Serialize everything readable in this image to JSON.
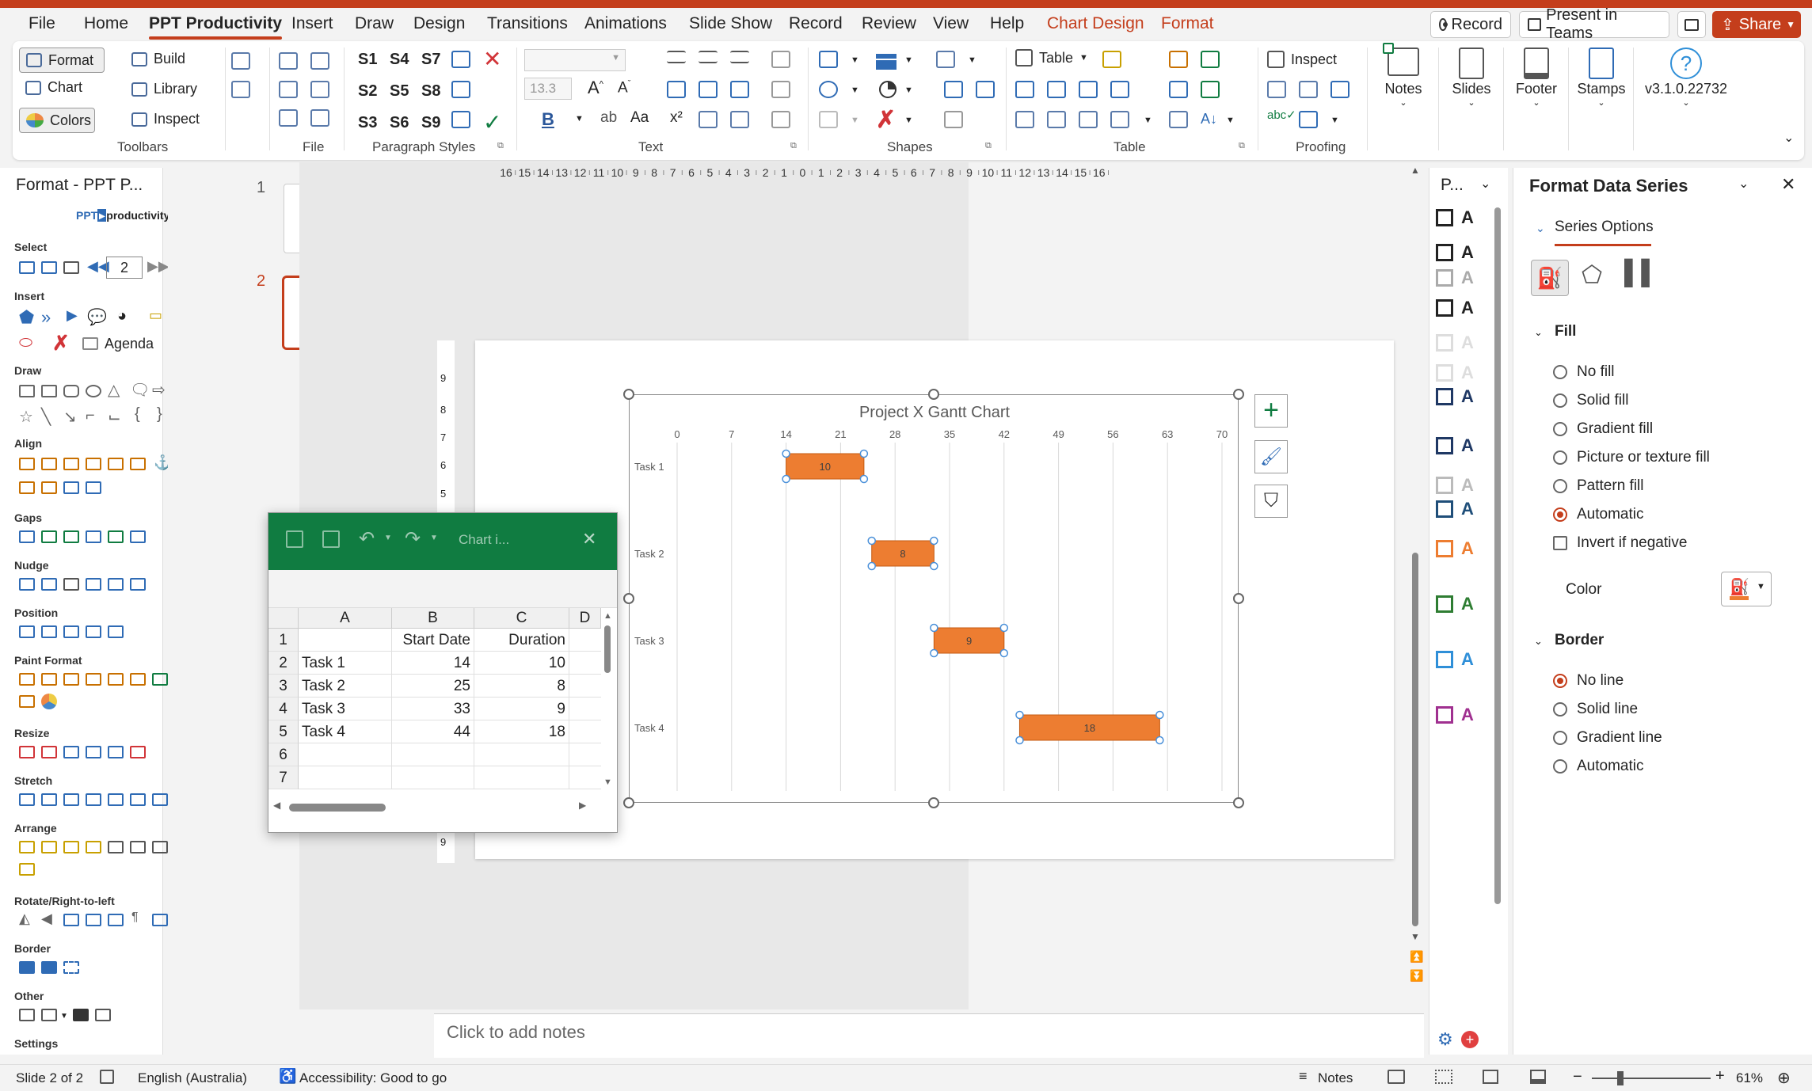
{
  "menu": {
    "tabs": [
      "File",
      "Home",
      "PPT Productivity",
      "Insert",
      "Draw",
      "Design",
      "Transitions",
      "Animations",
      "Slide Show",
      "Record",
      "Review",
      "View",
      "Help",
      "Chart Design",
      "Format"
    ],
    "active_tab": "PPT Productivity",
    "record_btn": "Record",
    "present_btn": "Present in Teams",
    "share_btn": "Share"
  },
  "ribbon": {
    "toolbars": {
      "format": "Format",
      "chart": "Chart",
      "colors": "Colors",
      "build": "Build",
      "library": "Library",
      "inspect": "Inspect",
      "label": "Toolbars"
    },
    "file_label": "File",
    "paragraph_styles": {
      "label": "Paragraph Styles",
      "s": [
        "S1",
        "S4",
        "S7",
        "S2",
        "S5",
        "S8",
        "S3",
        "S6",
        "S9"
      ]
    },
    "text": {
      "label": "Text",
      "font_size": "13.3"
    },
    "shapes_label": "Shapes",
    "table": {
      "label": "Table",
      "table_btn": "Table"
    },
    "proofing": {
      "label": "Proofing",
      "inspect": "Inspect"
    },
    "notes": "Notes",
    "slides": "Slides",
    "footer": "Footer",
    "stamps": "Stamps",
    "version": "v3.1.0.22732"
  },
  "left_pane": {
    "title": "Format - PPT P...",
    "logo": "productivity",
    "logo_prefix": "PPT",
    "sections": [
      "Select",
      "Insert",
      "Draw",
      "Align",
      "Gaps",
      "Nudge",
      "Position",
      "Paint Format",
      "Resize",
      "Stretch",
      "Arrange",
      "Rotate/Right-to-left",
      "Border",
      "Other",
      "Settings"
    ],
    "select_value": "2",
    "agenda": "Agenda"
  },
  "thumbnails": [
    "1",
    "2"
  ],
  "ruler": {
    "h_labels": [
      "16",
      "15",
      "14",
      "13",
      "12",
      "11",
      "10",
      "9",
      "8",
      "7",
      "6",
      "5",
      "4",
      "3",
      "2",
      "1",
      "0",
      "1",
      "2",
      "3",
      "4",
      "5",
      "6",
      "7",
      "8",
      "9",
      "10",
      "11",
      "12",
      "13",
      "14",
      "15",
      "16"
    ],
    "v_labels": [
      "9",
      "8",
      "7",
      "6",
      "5",
      "4"
    ],
    "v_bottom": "9"
  },
  "notes_placeholder": "Click to add notes",
  "chart_data": {
    "type": "bar",
    "title": "Project X Gantt Chart",
    "orientation": "horizontal-gantt",
    "categories": [
      "Task 1",
      "Task 2",
      "Task 3",
      "Task 4"
    ],
    "series": [
      {
        "name": "Start Date",
        "values": [
          14,
          25,
          33,
          44
        ],
        "hidden": true
      },
      {
        "name": "Duration",
        "values": [
          10,
          8,
          9,
          18
        ],
        "color": "#ed7d31"
      }
    ],
    "x_ticks": [
      "0",
      "7",
      "14",
      "21",
      "28",
      "35",
      "42",
      "49",
      "56",
      "63",
      "70"
    ],
    "xlim": [
      0,
      70
    ],
    "grid": true
  },
  "worksheet": {
    "title": "Chart i...",
    "columns": [
      "A",
      "B",
      "C",
      "D"
    ],
    "rows": [
      "1",
      "2",
      "3",
      "4",
      "5",
      "6",
      "7"
    ],
    "cells": [
      [
        "",
        "Start Date",
        "Duration"
      ],
      [
        "Task 1",
        "14",
        "10"
      ],
      [
        "Task 2",
        "25",
        "8"
      ],
      [
        "Task 3",
        "33",
        "9"
      ],
      [
        "Task 4",
        "44",
        "18"
      ],
      [
        "",
        "",
        ""
      ],
      [
        "",
        "",
        ""
      ]
    ]
  },
  "style_pane": {
    "title": "P..."
  },
  "format_pane": {
    "title": "Format Data Series",
    "series_options": "Series Options",
    "fill": {
      "label": "Fill",
      "options": [
        "No fill",
        "Solid fill",
        "Gradient fill",
        "Picture or texture fill",
        "Pattern fill",
        "Automatic"
      ],
      "selected": "Automatic",
      "invert": "Invert if negative",
      "color_label": "Color"
    },
    "border": {
      "label": "Border",
      "options": [
        "No line",
        "Solid line",
        "Gradient line",
        "Automatic"
      ],
      "selected": "No line"
    }
  },
  "status": {
    "slide": "Slide 2 of 2",
    "language": "English (Australia)",
    "accessibility": "Accessibility: Good to go",
    "notes": "Notes",
    "zoom": "61%"
  },
  "colors": {
    "accent": "#c43e1c",
    "bar": "#ed7d31",
    "excel_green": "#107c41"
  }
}
